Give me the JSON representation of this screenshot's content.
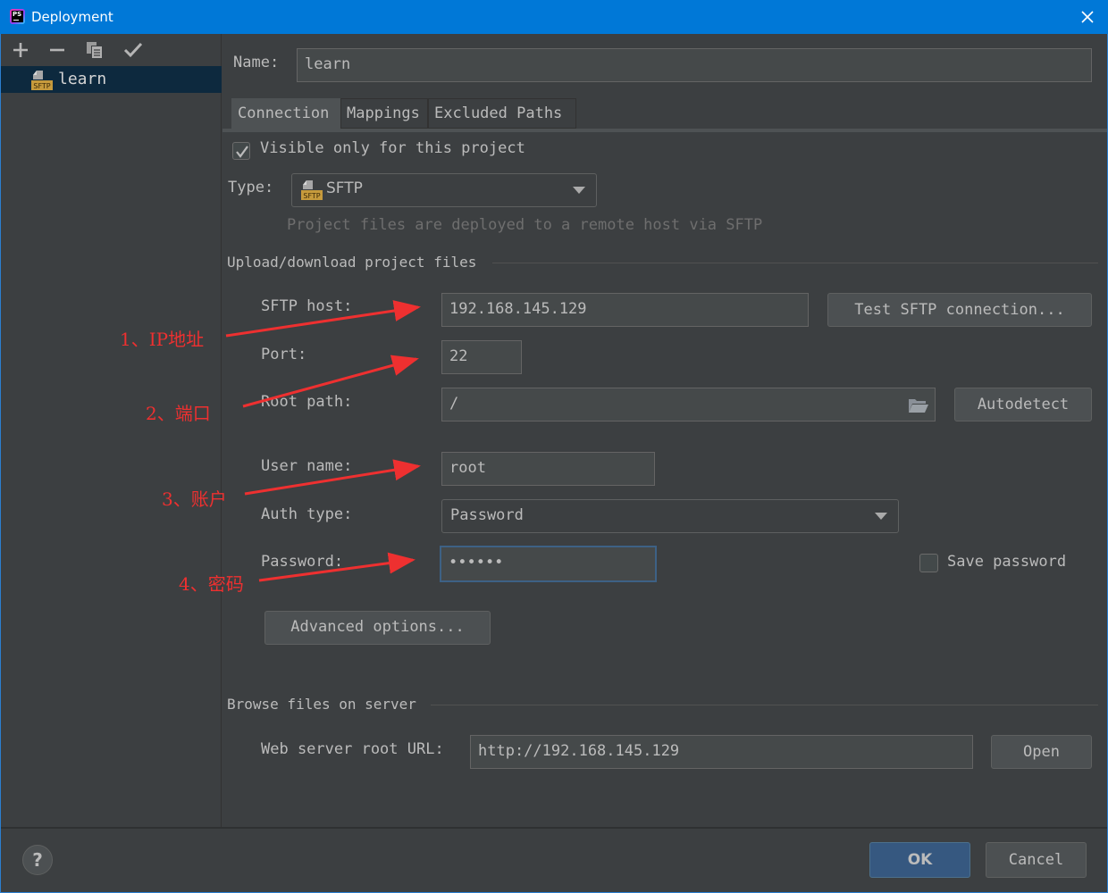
{
  "window": {
    "title": "Deployment",
    "app_icon": "phpstorm-icon",
    "close_icon": "close-icon"
  },
  "sidebar": {
    "toolbar": [
      {
        "name": "add-button",
        "icon": "plus-icon",
        "glyph": "+"
      },
      {
        "name": "remove-button",
        "icon": "minus-icon",
        "glyph": "−"
      },
      {
        "name": "copy-button",
        "icon": "copy-icon",
        "glyph": "⎘"
      },
      {
        "name": "set-default-button",
        "icon": "check-icon",
        "glyph": "✓"
      }
    ],
    "servers": [
      {
        "label": "learn",
        "icon": "sftp-server-icon",
        "icon_badge": "SFTP",
        "selected": true
      }
    ]
  },
  "form": {
    "name_label": "Name:",
    "name_value": "learn",
    "tabs": [
      {
        "label": "Connection",
        "active": true
      },
      {
        "label": "Mappings",
        "active": false
      },
      {
        "label": "Excluded Paths",
        "active": false
      }
    ],
    "visible_only_label": "Visible only for this project",
    "visible_only_checked": true,
    "type_label": "Type:",
    "type_value": "SFTP",
    "type_icon_badge": "SFTP",
    "type_hint": "Project files are deployed to a remote host via SFTP",
    "upload_group_title": "Upload/download project files",
    "sftp_host_label": "SFTP host:",
    "sftp_host_value": "192.168.145.129",
    "test_connection_label": "Test SFTP connection...",
    "port_label": "Port:",
    "port_value": "22",
    "root_path_label": "Root path:",
    "root_path_value": "/",
    "autodetect_label": "Autodetect",
    "user_name_label": "User name:",
    "user_name_value": "root",
    "auth_type_label": "Auth type:",
    "auth_type_value": "Password",
    "password_label": "Password:",
    "password_value": "••••••",
    "save_password_label": "Save password",
    "save_password_checked": false,
    "advanced_options_label": "Advanced options...",
    "browse_group_title": "Browse files on server",
    "web_root_label": "Web server root URL:",
    "web_root_value": "http://192.168.145.129",
    "open_label": "Open"
  },
  "footer": {
    "help_label": "?",
    "ok_label": "OK",
    "cancel_label": "Cancel"
  },
  "annotations": [
    {
      "text": "1、IP地址",
      "target": "sftp-host"
    },
    {
      "text": "2、端口",
      "target": "port"
    },
    {
      "text": "3、账户",
      "target": "user-name"
    },
    {
      "text": "4、密码",
      "target": "password"
    }
  ],
  "colors": {
    "titlebar": "#0078d7",
    "background": "#3c3f41",
    "selection": "#0d293e",
    "focus_border": "#3d6185",
    "ok_button": "#365880",
    "annotation": "#ee3030",
    "sftp_badge": "#c69a3c"
  }
}
